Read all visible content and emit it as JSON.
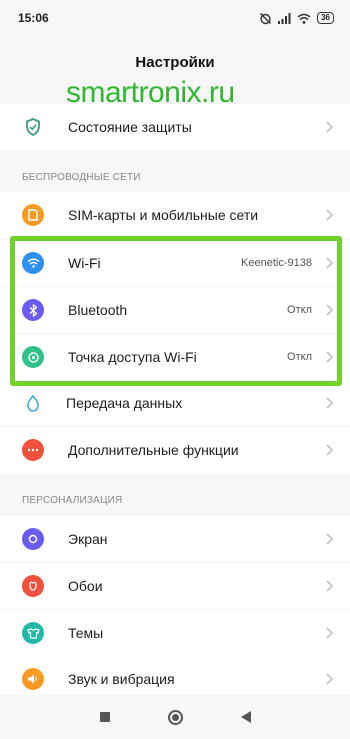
{
  "status_bar": {
    "time": "15:06",
    "battery": "36",
    "icons": [
      "alarm-off-icon",
      "signal-icon",
      "wifi-icon",
      "battery-icon"
    ]
  },
  "header": {
    "title": "Настройки"
  },
  "watermark": "smartronix.ru",
  "rows": [
    {
      "id": "protection",
      "label": "Состояние защиты",
      "value": "",
      "icon": "shield-icon",
      "color": "#3a9c7a"
    },
    {
      "id": "sim",
      "label": "SIM-карты и мобильные сети",
      "value": "",
      "icon": "sim-icon",
      "color": "#f59a23"
    },
    {
      "id": "wifi",
      "label": "Wi-Fi",
      "value": "Keenetic-9138",
      "icon": "wifi-icon",
      "color": "#2f8ff0"
    },
    {
      "id": "bluetooth",
      "label": "Bluetooth",
      "value": "Откл",
      "icon": "bluetooth-icon",
      "color": "#6a5cf0"
    },
    {
      "id": "hotspot",
      "label": "Точка доступа Wi-Fi",
      "value": "Откл",
      "icon": "hotspot-icon",
      "color": "#2fc28b"
    },
    {
      "id": "data",
      "label": "Передача данных",
      "value": "",
      "icon": "data-drop-icon",
      "color": "#3fa7d6"
    },
    {
      "id": "extra",
      "label": "Дополнительные функции",
      "value": "",
      "icon": "more-dots-icon",
      "color": "#f0503c"
    },
    {
      "id": "screen",
      "label": "Экран",
      "value": "",
      "icon": "brightness-icon",
      "color": "#6a5cf0"
    },
    {
      "id": "wallpaper",
      "label": "Обои",
      "value": "",
      "icon": "flower-icon",
      "color": "#f0503c"
    },
    {
      "id": "themes",
      "label": "Темы",
      "value": "",
      "icon": "themes-icon",
      "color": "#21b8a6"
    },
    {
      "id": "sound",
      "label": "Звук и вибрация",
      "value": "",
      "icon": "speaker-icon",
      "color": "#f59a23"
    }
  ],
  "sections": {
    "wireless": "БЕСПРОВОДНЫЕ СЕТИ",
    "personalization": "ПЕРСОНАЛИЗАЦИЯ"
  },
  "highlight_color": "#6fd12a"
}
